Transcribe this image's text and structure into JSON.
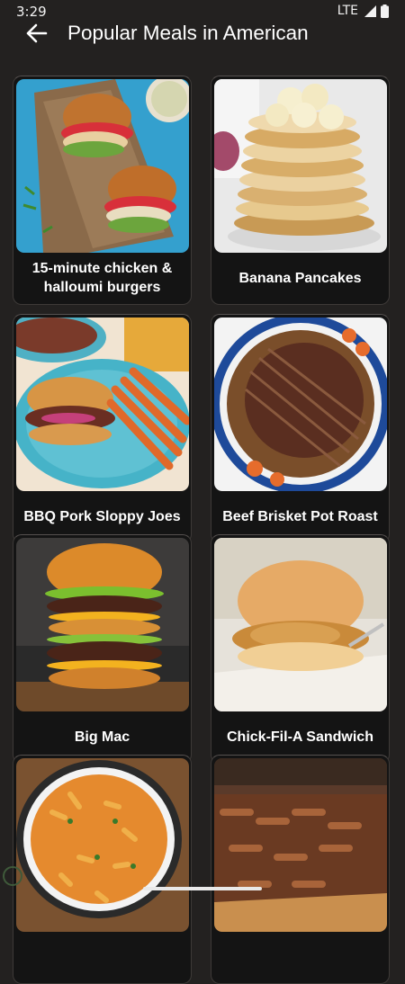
{
  "status": {
    "time": "3:29",
    "network": "LTE",
    "icons": [
      "signal-icon",
      "battery-icon"
    ]
  },
  "header": {
    "title": "Popular Meals in American",
    "back_icon": "arrow-left-icon"
  },
  "meals": [
    {
      "title": "15-minute chicken & halloumi burgers"
    },
    {
      "title": "Banana Pancakes"
    },
    {
      "title": "BBQ Pork Sloppy Joes"
    },
    {
      "title": "Beef Brisket Pot Roast"
    },
    {
      "title": "Big Mac"
    },
    {
      "title": "Chick-Fil-A Sandwich"
    },
    {
      "title": ""
    },
    {
      "title": ""
    }
  ],
  "colors": {
    "background": "#232120",
    "card": "#141414",
    "text": "#ffffff"
  }
}
